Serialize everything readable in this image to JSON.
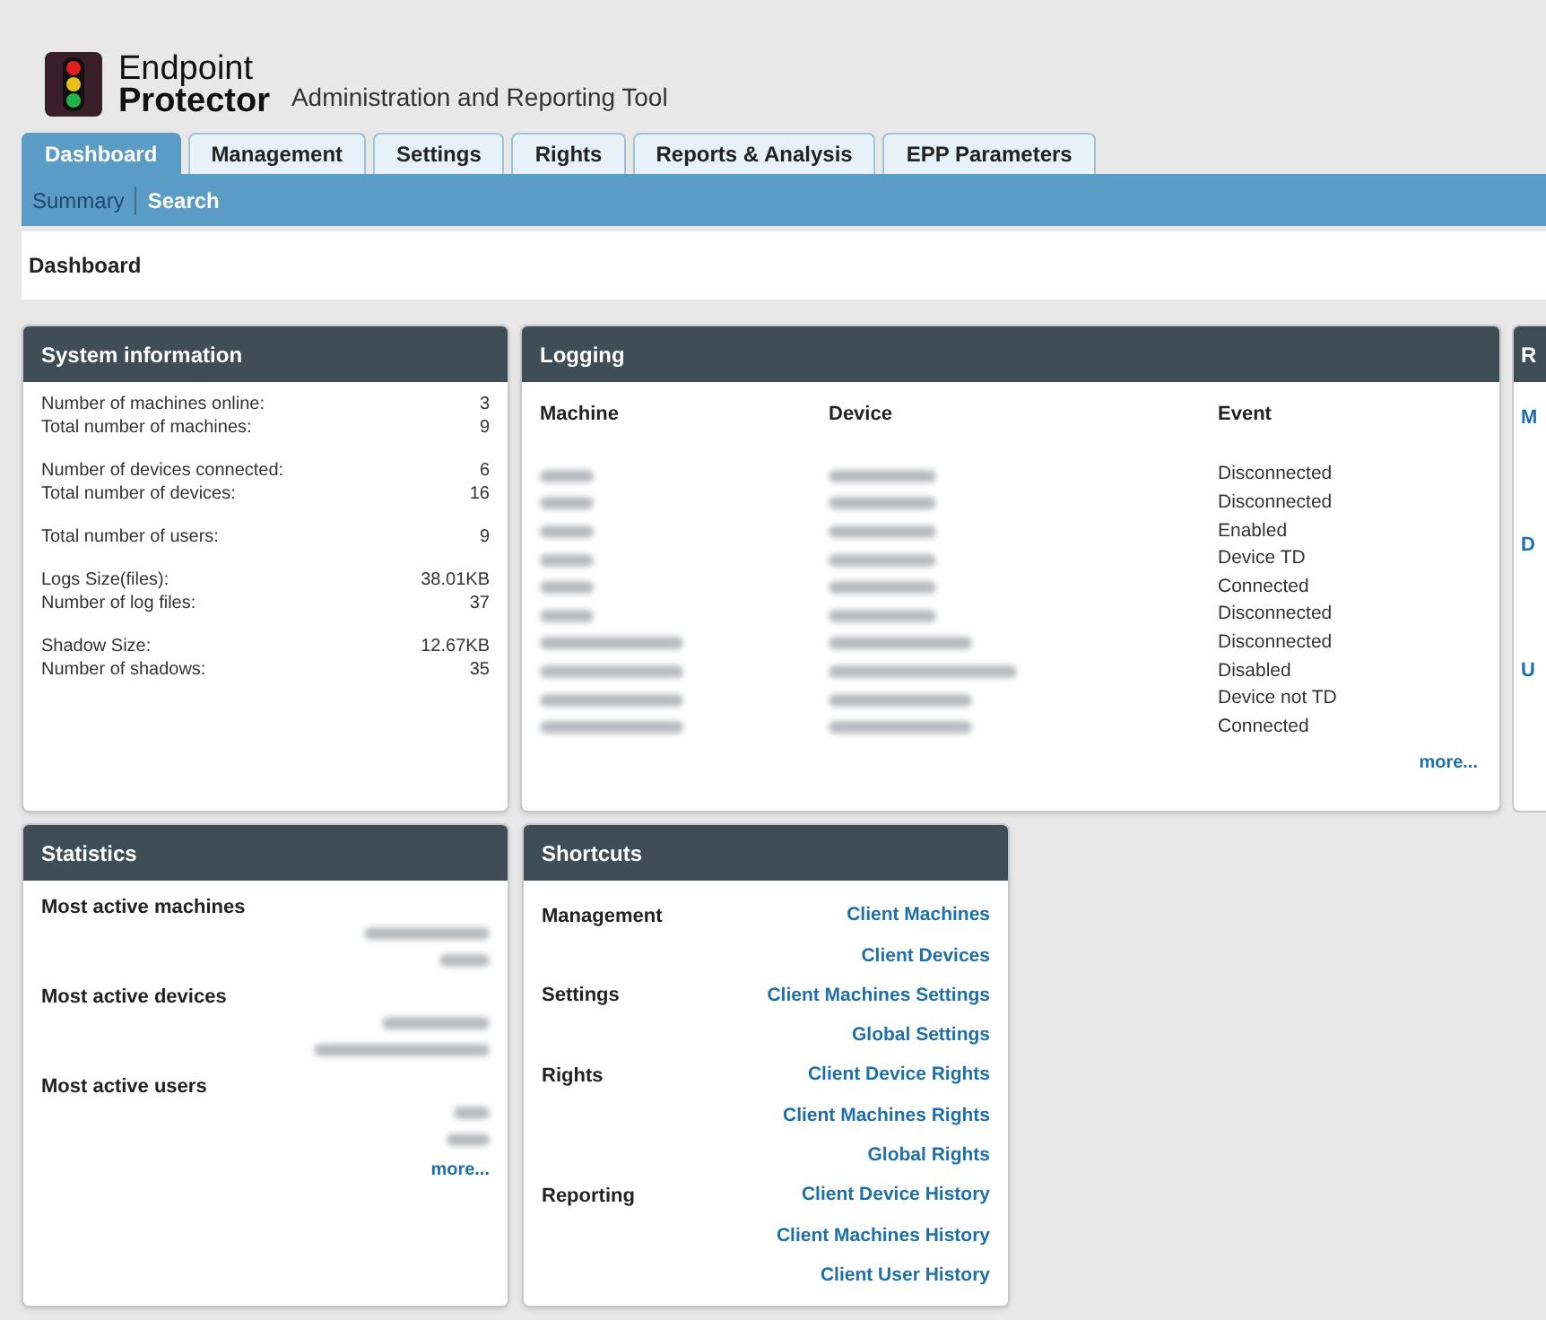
{
  "header": {
    "brand_line_1": "Endpoint",
    "brand_line_2": "Protector",
    "subtitle": "Administration and Reporting Tool"
  },
  "tabs": [
    {
      "label": "Dashboard",
      "selected": true
    },
    {
      "label": "Management",
      "selected": false
    },
    {
      "label": "Settings",
      "selected": false
    },
    {
      "label": "Rights",
      "selected": false
    },
    {
      "label": "Reports & Analysis",
      "selected": false
    },
    {
      "label": "EPP Parameters",
      "selected": false
    }
  ],
  "subnav": [
    {
      "label": "Summary",
      "selected": true
    },
    {
      "label": "Search",
      "selected": false
    }
  ],
  "page_title": "Dashboard",
  "system_information": {
    "title": "System information",
    "groups": [
      [
        {
          "label": "Number of machines online:",
          "value": "3"
        },
        {
          "label": "Total number of machines:",
          "value": "9"
        }
      ],
      [
        {
          "label": "Number of devices connected:",
          "value": "6"
        },
        {
          "label": "Total number of devices:",
          "value": "16"
        }
      ],
      [
        {
          "label": "Total number of users:",
          "value": "9"
        }
      ],
      [
        {
          "label": "Logs Size(files):",
          "value": "38.01KB"
        },
        {
          "label": "Number of log files:",
          "value": "37"
        }
      ],
      [
        {
          "label": "Shadow Size:",
          "value": "12.67KB"
        },
        {
          "label": "Number of shadows:",
          "value": "35"
        }
      ]
    ]
  },
  "logging": {
    "title": "Logging",
    "columns": [
      "Machine",
      "Device",
      "Event"
    ],
    "rows": [
      {
        "event": "Disconnected"
      },
      {
        "event": "Disconnected"
      },
      {
        "event": "Enabled"
      },
      {
        "event": "Device TD"
      },
      {
        "event": "Connected"
      },
      {
        "event": "Disconnected"
      },
      {
        "event": "Disconnected"
      },
      {
        "event": "Disabled"
      },
      {
        "event": "Device not TD"
      },
      {
        "event": "Connected"
      }
    ],
    "more": "more..."
  },
  "right_panel": {
    "title": "R",
    "links": [
      "M",
      "D",
      "U"
    ]
  },
  "statistics": {
    "title": "Statistics",
    "sections": [
      "Most active machines",
      "Most active devices",
      "Most active users"
    ],
    "more": "more..."
  },
  "shortcuts": {
    "title": "Shortcuts",
    "groups": [
      {
        "label": "Management",
        "links": [
          "Client Machines",
          "Client Devices"
        ]
      },
      {
        "label": "Settings",
        "links": [
          "Client Machines Settings",
          "Global Settings"
        ]
      },
      {
        "label": "Rights",
        "links": [
          "Client Device Rights",
          "Client Machines Rights",
          "Global Rights"
        ]
      },
      {
        "label": "Reporting",
        "links": [
          "Client Device History",
          "Client Machines History",
          "Client User History"
        ]
      }
    ]
  }
}
